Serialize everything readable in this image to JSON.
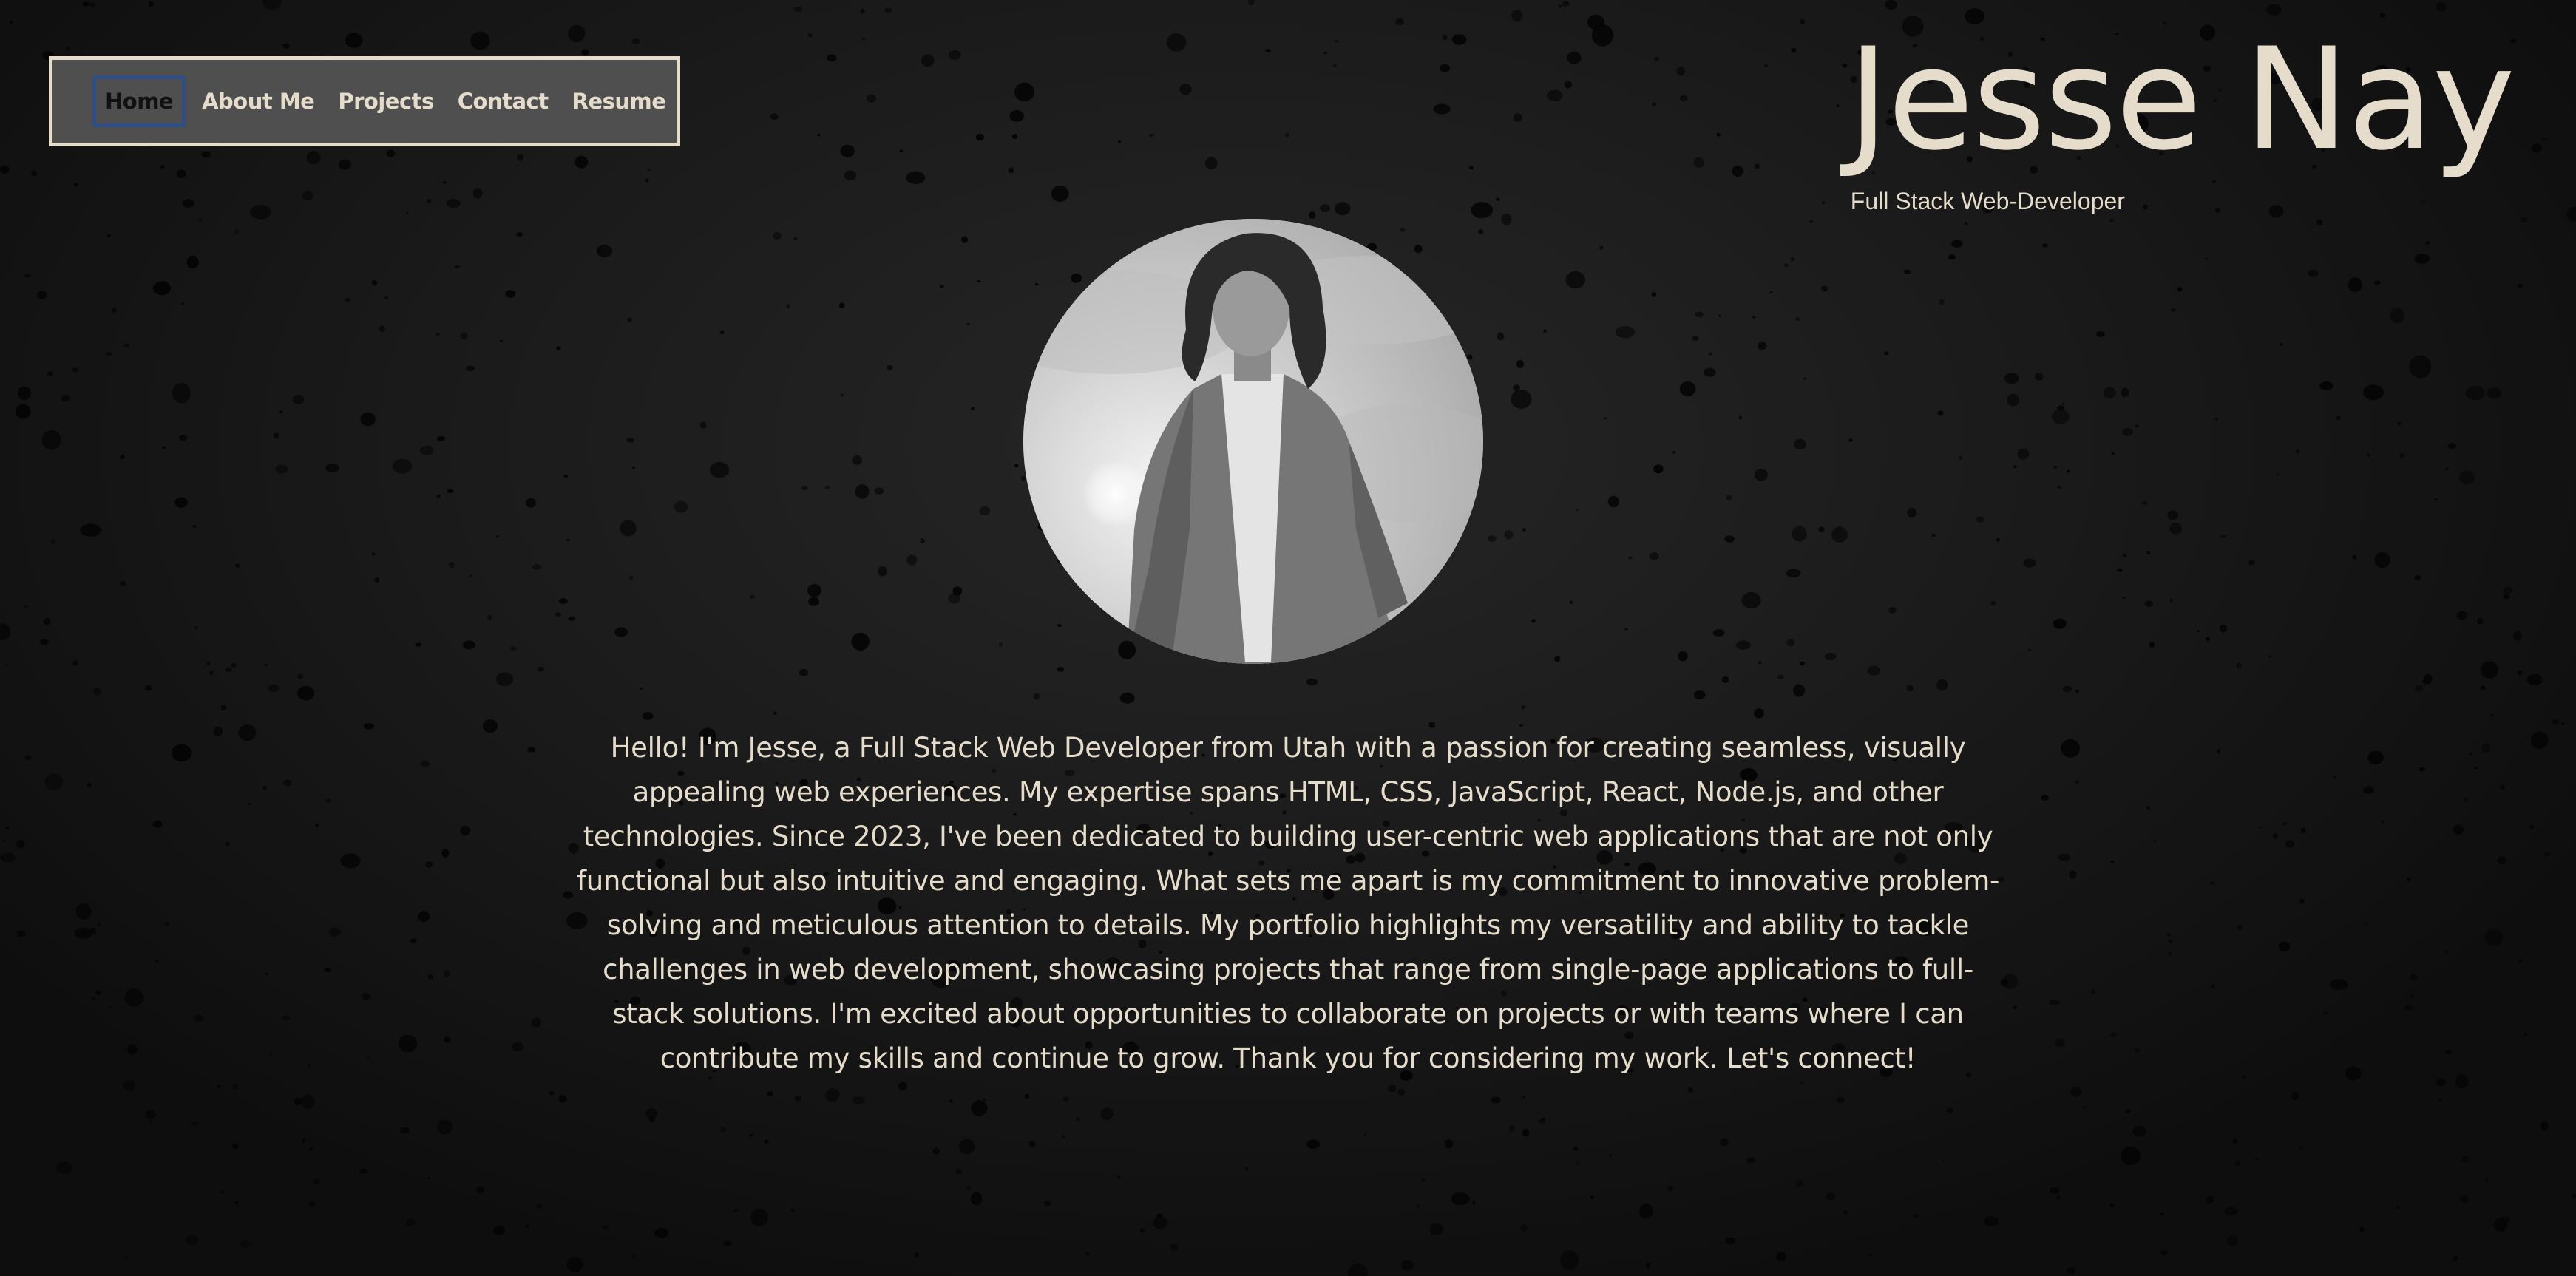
{
  "nav": {
    "items": [
      {
        "label": "Home",
        "active": true
      },
      {
        "label": "About Me",
        "active": false
      },
      {
        "label": "Projects",
        "active": false
      },
      {
        "label": "Contact",
        "active": false
      },
      {
        "label": "Resume",
        "active": false
      }
    ]
  },
  "header": {
    "name": "Jesse Nay",
    "subtitle": "Full Stack Web-Developer"
  },
  "profile": {
    "photo_icon": "profile-photo"
  },
  "about": {
    "bio": "Hello! I'm Jesse, a Full Stack Web Developer from Utah with a passion for creating seamless, visually appealing web experiences. My expertise spans HTML, CSS, JavaScript, React, Node.js, and other technologies. Since 2023, I've been dedicated to building user-centric web applications that are not only functional but also intuitive and engaging. What sets me apart is my commitment to innovative problem-solving and meticulous attention to details. My portfolio highlights my versatility and ability to tackle challenges in web development, showcasing projects that range from single-page applications to full-stack solutions. I'm excited about opportunities to collaborate on projects or with teams where I can contribute my skills and continue to grow. Thank you for considering my work. Let's connect!"
  },
  "colors": {
    "accent": "#e5dccb",
    "nav_bg": "#4f4f4f",
    "active_border": "#2f4e86",
    "background": "#1a1a1a"
  }
}
